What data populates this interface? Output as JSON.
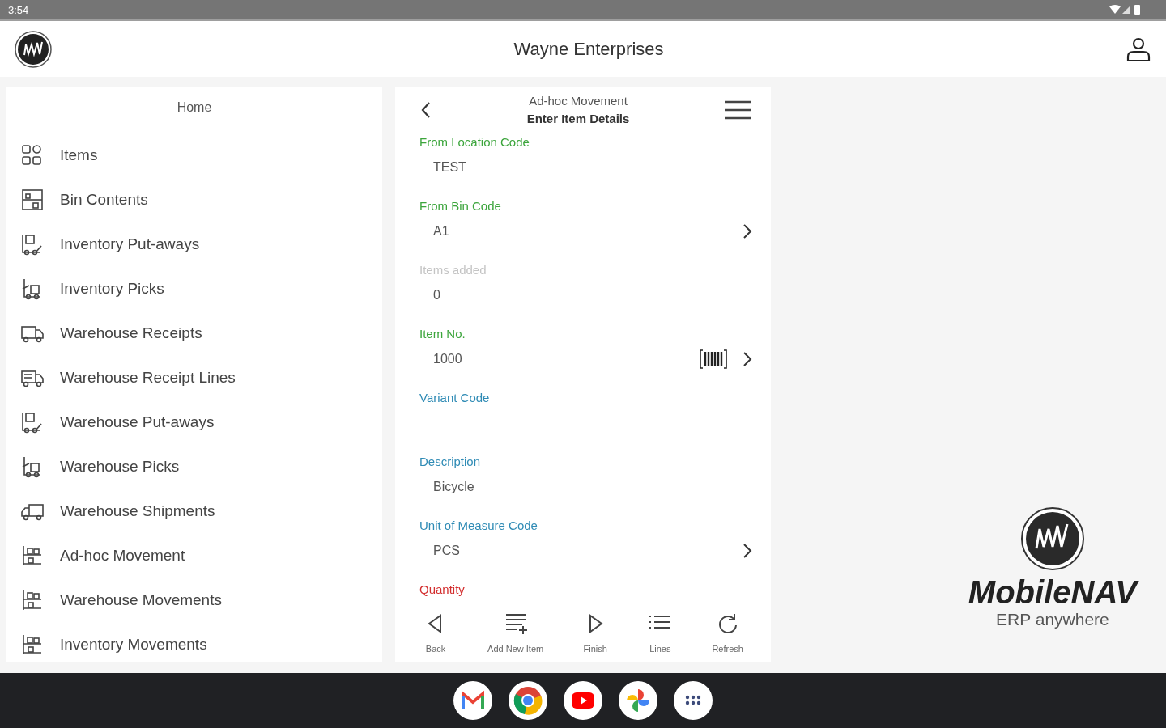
{
  "status_bar": {
    "time": "3:54"
  },
  "header": {
    "title": "Wayne Enterprises"
  },
  "menu": {
    "title": "Home",
    "items": [
      {
        "label": "Items",
        "kind": "grid"
      },
      {
        "label": "Bin Contents",
        "kind": "bin"
      },
      {
        "label": "Inventory Put-aways",
        "kind": "putaway"
      },
      {
        "label": "Inventory Picks",
        "kind": "pick"
      },
      {
        "label": "Warehouse Receipts",
        "kind": "truck"
      },
      {
        "label": "Warehouse Receipt Lines",
        "kind": "truck-lines"
      },
      {
        "label": "Warehouse Put-aways",
        "kind": "putaway"
      },
      {
        "label": "Warehouse Picks",
        "kind": "pick"
      },
      {
        "label": "Warehouse Shipments",
        "kind": "ship"
      },
      {
        "label": "Ad-hoc Movement",
        "kind": "shelf"
      },
      {
        "label": "Warehouse Movements",
        "kind": "shelf"
      },
      {
        "label": "Inventory Movements",
        "kind": "shelf"
      }
    ]
  },
  "form": {
    "title": "Ad-hoc Movement",
    "subtitle": "Enter Item Details",
    "fields": [
      {
        "label": "From Location Code",
        "value": "TEST",
        "color": "#3ca53c",
        "chevron": false,
        "barcode": false
      },
      {
        "label": "From Bin Code",
        "value": "A1",
        "color": "#3ca53c",
        "chevron": true,
        "barcode": false
      },
      {
        "label": "Items added",
        "value": "0",
        "color": "#c4c4c4",
        "chevron": false,
        "barcode": false
      },
      {
        "label": "Item No.",
        "value": "1000",
        "color": "#3ca53c",
        "chevron": true,
        "barcode": true
      },
      {
        "label": "Variant Code",
        "color": "#2f8bb5",
        "chevron": false,
        "barcode": false
      },
      {
        "label": "Description",
        "value": "Bicycle",
        "color": "#2f8bb5",
        "chevron": false,
        "barcode": false
      },
      {
        "label": "Unit of Measure Code",
        "value": "PCS",
        "color": "#2f8bb5",
        "chevron": true,
        "barcode": false
      },
      {
        "label": "Quantity",
        "color": "#d32f2f",
        "chevron": false,
        "barcode": false
      }
    ],
    "toolbar": [
      {
        "label": "Back",
        "kind": "back"
      },
      {
        "label": "Add New Item",
        "kind": "add"
      },
      {
        "label": "Finish",
        "kind": "finish"
      },
      {
        "label": "Lines",
        "kind": "lines"
      },
      {
        "label": "Refresh",
        "kind": "refresh"
      }
    ]
  },
  "brand": {
    "name": "MobileNAV",
    "tagline": "ERP anywhere"
  },
  "dock": [
    {
      "kind": "mail"
    },
    {
      "kind": "browser"
    },
    {
      "kind": "video"
    },
    {
      "kind": "photos"
    },
    {
      "kind": "apps"
    }
  ]
}
